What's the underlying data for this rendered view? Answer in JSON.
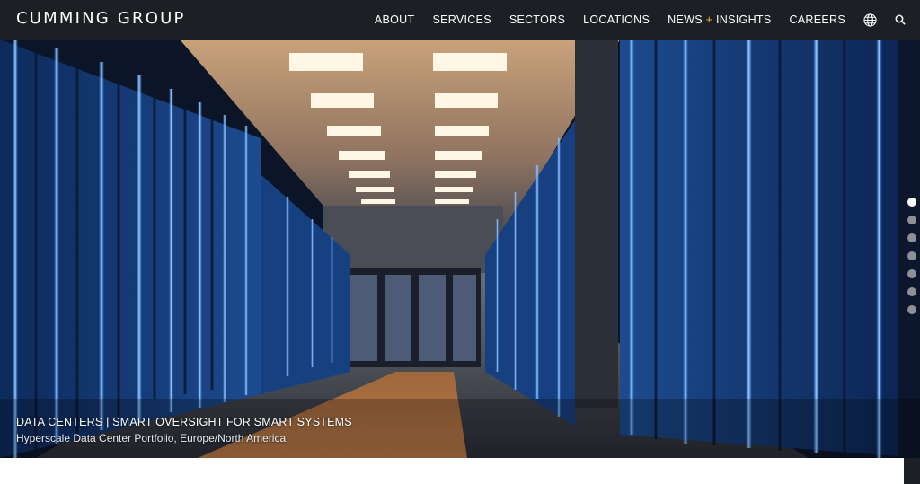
{
  "brand": {
    "logo_text": "CUMMING GROUP"
  },
  "nav": {
    "items": [
      {
        "label": "ABOUT"
      },
      {
        "label": "SERVICES"
      },
      {
        "label": "SECTORS"
      },
      {
        "label": "LOCATIONS"
      },
      {
        "label_before": "NEWS",
        "label_plus": "+",
        "label_after": "INSIGHTS"
      },
      {
        "label": "CAREERS"
      }
    ],
    "icons": [
      "globe-icon",
      "search-icon"
    ]
  },
  "hero": {
    "caption_title": "DATA CENTERS | SMART OVERSIGHT FOR SMART SYSTEMS",
    "caption_subtitle": "Hyperscale Data Center Portfolio, Europe/North America",
    "slide_count": 7,
    "active_slide": 1
  },
  "colors": {
    "header_bg": "#1c1f24",
    "accent_plus": "#f2b233",
    "dot_active": "#ffffff",
    "dot_inactive": "#8d9097"
  }
}
